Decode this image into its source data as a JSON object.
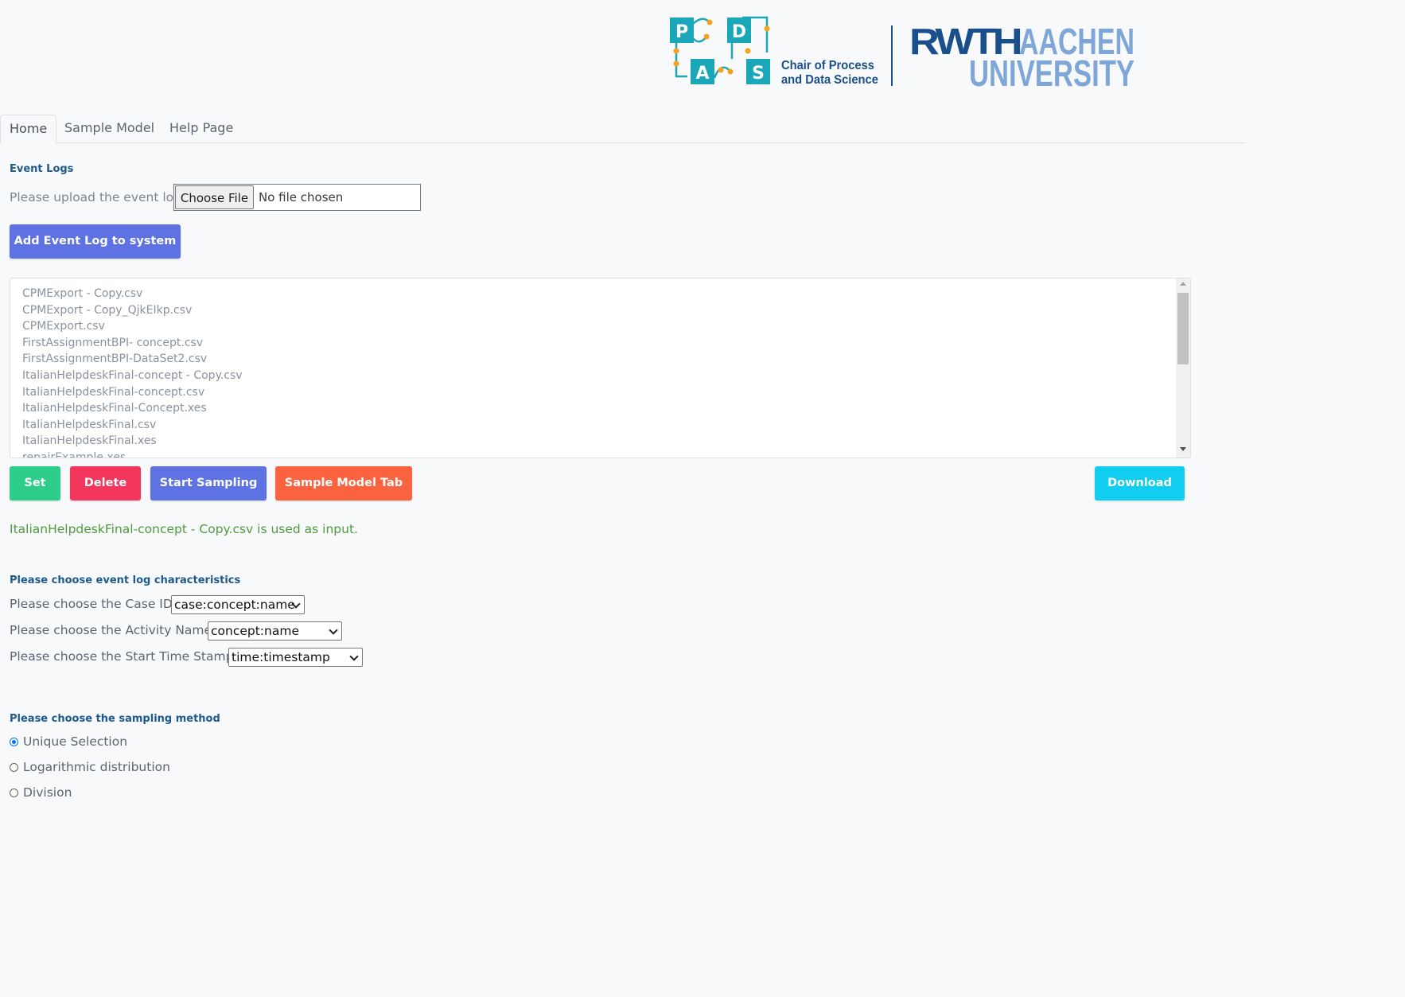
{
  "header": {
    "pads_logo_letters": [
      "P",
      "D",
      "A",
      "S"
    ],
    "chair_line1": "Chair of Process",
    "chair_line2": "and Data Science",
    "rwth_part1": "RWTH",
    "rwth_part2": "AACHEN",
    "rwth_part3": "UNIVERSITY",
    "colors": {
      "pads_teal": "#1aa8b8",
      "pads_orange": "#f5a31a",
      "rwth_dark": "#1a4f8c",
      "rwth_light": "#7ea6d8"
    }
  },
  "tabs": [
    {
      "label": "Home",
      "active": true
    },
    {
      "label": "Sample Model",
      "active": false
    },
    {
      "label": "Help Page",
      "active": false
    }
  ],
  "event_logs": {
    "section_title": "Event Logs",
    "upload_label": "Please upload the event log:",
    "choose_file_label": "Choose File",
    "no_file_text": "No file chosen",
    "add_button_label": "Add Event Log to system",
    "files": [
      "CPMExport - Copy.csv",
      "CPMExport - Copy_QjkEIkp.csv",
      "CPMExport.csv",
      "FirstAssignmentBPI- concept.csv",
      "FirstAssignmentBPI-DataSet2.csv",
      "ItalianHelpdeskFinal-concept - Copy.csv",
      "ItalianHelpdeskFinal-concept.csv",
      "ItalianHelpdeskFinal-Concept.xes",
      "ItalianHelpdeskFinal.csv",
      "ItalianHelpdeskFinal.xes",
      "repairExample.xes"
    ]
  },
  "actions": {
    "set": "Set",
    "delete": "Delete",
    "start_sampling": "Start Sampling",
    "sample_model_tab": "Sample Model Tab",
    "download": "Download",
    "colors": {
      "set": "#2dce89",
      "delete": "#f5365c",
      "start_sampling": "#5e72e4",
      "sample_model_tab": "#fb6340",
      "download": "#11cdef",
      "add": "#5e72e4"
    }
  },
  "status_message": "ItalianHelpdeskFinal-concept - Copy.csv is used as input.",
  "characteristics": {
    "section_title": "Please choose event log characteristics",
    "case_id_label": "Please choose the Case ID:",
    "case_id_value": "case:concept:name",
    "activity_label": "Please choose the Activity Name:",
    "activity_value": "concept:name",
    "timestamp_label": "Please choose the Start Time Stamp:",
    "timestamp_value": "time:timestamp"
  },
  "sampling": {
    "section_title": "Please choose the sampling method",
    "options": [
      {
        "label": "Unique Selection",
        "checked": true
      },
      {
        "label": "Logarithmic distribution",
        "checked": false
      },
      {
        "label": "Division",
        "checked": false
      }
    ]
  }
}
